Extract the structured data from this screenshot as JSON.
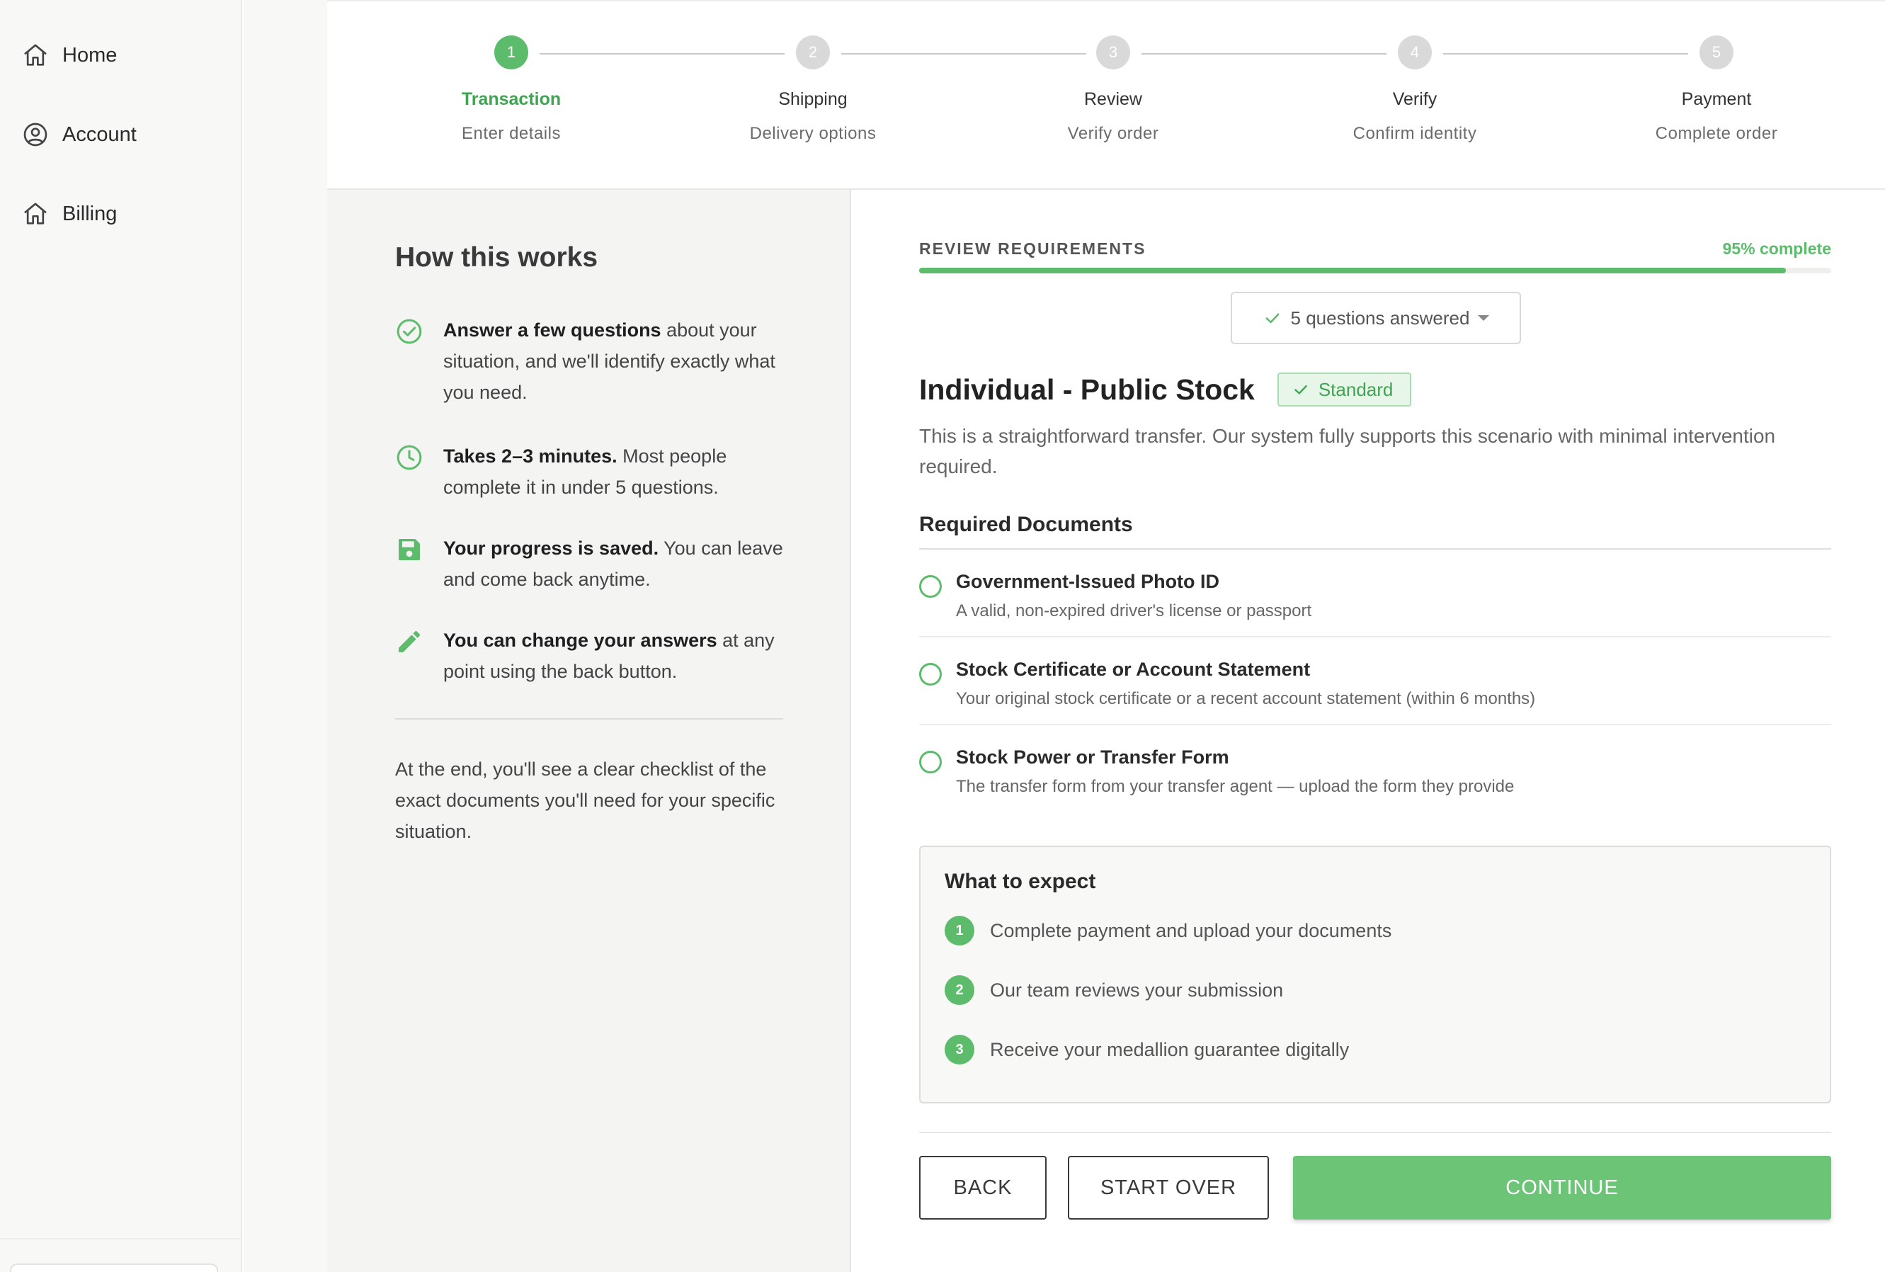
{
  "sidebar": {
    "items": [
      {
        "label": "Home",
        "icon": "home-icon"
      },
      {
        "label": "Account",
        "icon": "user-circle-icon"
      },
      {
        "label": "Billing",
        "icon": "home-icon"
      }
    ]
  },
  "stepper": {
    "steps": [
      {
        "number": "1",
        "title": "Transaction",
        "subtitle": "Enter details",
        "active": true
      },
      {
        "number": "2",
        "title": "Shipping",
        "subtitle": "Delivery options",
        "active": false
      },
      {
        "number": "3",
        "title": "Review",
        "subtitle": "Verify order",
        "active": false
      },
      {
        "number": "4",
        "title": "Verify",
        "subtitle": "Confirm identity",
        "active": false
      },
      {
        "number": "5",
        "title": "Payment",
        "subtitle": "Complete order",
        "active": false
      }
    ]
  },
  "info": {
    "title": "How this works",
    "items": [
      {
        "icon": "check-circle-icon",
        "bold": "Answer a few questions",
        "rest": " about your situation, and we'll identify exactly what you need."
      },
      {
        "icon": "clock-icon",
        "bold": "Takes 2–3 minutes.",
        "rest": " Most people complete it in under 5 questions."
      },
      {
        "icon": "save-icon",
        "bold": "Your progress is saved.",
        "rest": " You can leave and come back anytime."
      },
      {
        "icon": "pencil-icon",
        "bold": "You can change your answers",
        "rest": " at any point using the back button."
      }
    ],
    "footer": "At the end, you'll see a clear checklist of the exact documents you'll need for your specific situation."
  },
  "review": {
    "label": "REVIEW REQUIREMENTS",
    "percent_text": "95% complete",
    "progress": 0.95,
    "answered": "5 questions answered"
  },
  "scenario": {
    "title": "Individual - Public Stock",
    "badge": "Standard",
    "description": "This is a straightforward transfer. Our system fully supports this scenario with minimal intervention required."
  },
  "documents": {
    "title": "Required Documents",
    "items": [
      {
        "name": "Government-Issued Photo ID",
        "desc": "A valid, non-expired driver's license or passport"
      },
      {
        "name": "Stock Certificate or Account Statement",
        "desc": "Your original stock certificate or a recent account statement (within 6 months)"
      },
      {
        "name": "Stock Power or Transfer Form",
        "desc": "The transfer form from your transfer agent — upload the form they provide"
      }
    ]
  },
  "expect": {
    "title": "What to expect",
    "items": [
      {
        "number": "1",
        "text": "Complete payment and upload your documents"
      },
      {
        "number": "2",
        "text": "Our team reviews your submission"
      },
      {
        "number": "3",
        "text": "Receive your medallion guarantee digitally"
      }
    ]
  },
  "actions": {
    "back": "BACK",
    "start_over": "START OVER",
    "continue": "CONTINUE"
  },
  "colors": {
    "accent": "#5cbc6b",
    "accent_dark": "#3fa552",
    "continue_bg": "#6cc477"
  }
}
